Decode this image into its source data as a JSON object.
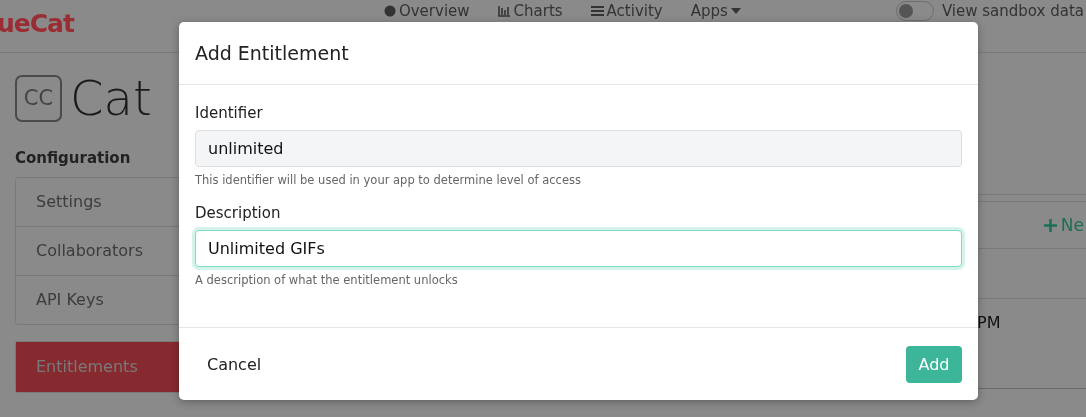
{
  "header": {
    "logo": "ueCat",
    "nav": [
      {
        "label": "Overview",
        "kind": "dot"
      },
      {
        "label": "Charts",
        "kind": "bars"
      },
      {
        "label": "Activity",
        "kind": "list"
      },
      {
        "label": "Apps",
        "kind": "caret"
      }
    ],
    "sandbox": {
      "label": "View sandbox data",
      "on": false
    }
  },
  "app": {
    "badge": "CC",
    "title": "Cat"
  },
  "sidebar": {
    "heading": "Configuration",
    "groups": [
      [
        {
          "label": "Settings",
          "selected": false
        },
        {
          "label": "Collaborators",
          "selected": false
        },
        {
          "label": "API Keys",
          "selected": false
        }
      ],
      [
        {
          "label": "Entitlements",
          "selected": true
        }
      ]
    ]
  },
  "content": {
    "new_button": "Ne",
    "cell": "PM"
  },
  "modal": {
    "title": "Add Entitlement",
    "fields": [
      {
        "label": "Identifier",
        "value": "unlimited",
        "help": "This identifier will be used in your app to determine level of access",
        "focused": false
      },
      {
        "label": "Description",
        "value": "Unlimited GIFs",
        "help": "A description of what the entitlement unlocks",
        "focused": true
      }
    ],
    "cancel": "Cancel",
    "submit": "Add"
  }
}
